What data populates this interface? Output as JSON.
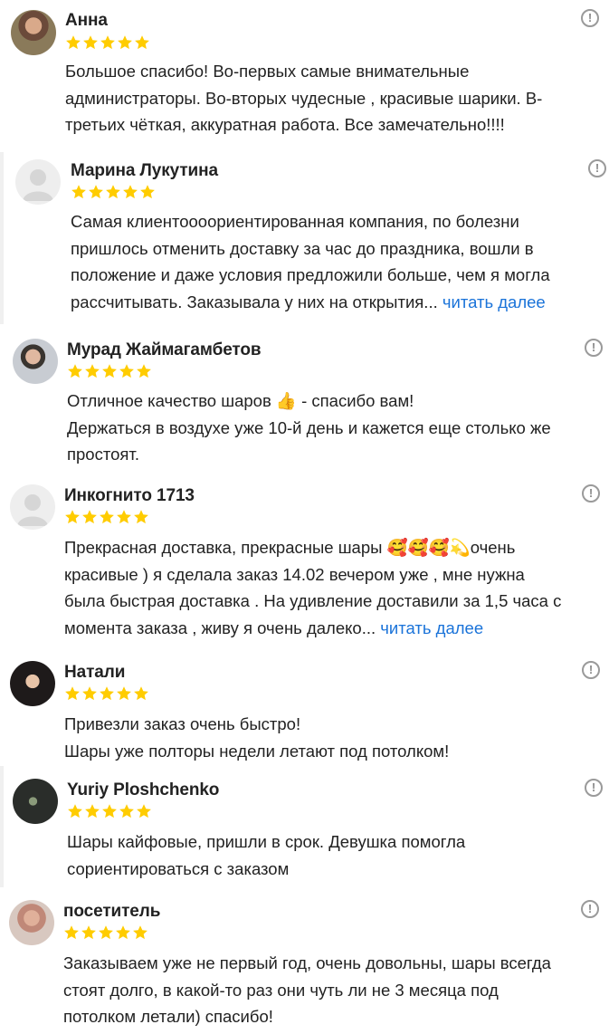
{
  "colors": {
    "star": "#FFCC00",
    "link": "#1a73d9",
    "report_icon": "#9a9a9a"
  },
  "icons": {
    "rating": "star-icon",
    "report": "report-icon",
    "avatar_placeholder": "user-silhouette-icon"
  },
  "reviews": [
    {
      "author": "Анна",
      "rating": 5,
      "text": "Большое спасибо! Во-первых самые внимательные\nадминистраторы. Во-вторых чудесные , красивые шарики. В-\nтретьих чёткая, аккуратная работа. Все замечательно!!!!",
      "more": ""
    },
    {
      "author": "Марина Лукутина",
      "rating": 5,
      "text": "Самая клиентоооориентированная компания, по болезни\nпришлось отменить доставку за час до праздника, вошли в\nположение и даже условия предложили больше, чем я могла\nрассчитывать. Заказывала у них на открытия... ",
      "more": "читать далее"
    },
    {
      "author": "Мурад Жаймагамбетов",
      "rating": 5,
      "text": "Отличное качество шаров 👍 - спасибо вам!\nДержаться в воздухе уже 10-й день и кажется еще столько же\nпростоят.",
      "more": ""
    },
    {
      "author": "Инкогнито 1713",
      "rating": 5,
      "text": "Прекрасная доставка, прекрасные шары 🥰🥰🥰💫очень\nкрасивые ) я сделала заказ 14.02 вечером уже , мне нужна\nбыла быстрая доставка . На удивление доставили за 1,5 часа с\nмомента заказа , живу я очень далеко... ",
      "more": "читать далее"
    },
    {
      "author": "Натали",
      "rating": 5,
      "text": "Привезли заказ очень быстро!\nШары уже полторы недели летают под потолком!",
      "more": ""
    },
    {
      "author": "Yuriy Ploshchenko",
      "rating": 5,
      "text": "Шары кайфовые, пришли в срок. Девушка помогла\nсориентироваться с заказом",
      "more": ""
    },
    {
      "author": "посетитель",
      "rating": 5,
      "text": "Заказываем уже не первый год, очень довольны, шары всегда\nстоят долго, в какой-то раз они чуть ли не 3 месяца под\nпотолком летали) спасибо!",
      "more": ""
    }
  ]
}
